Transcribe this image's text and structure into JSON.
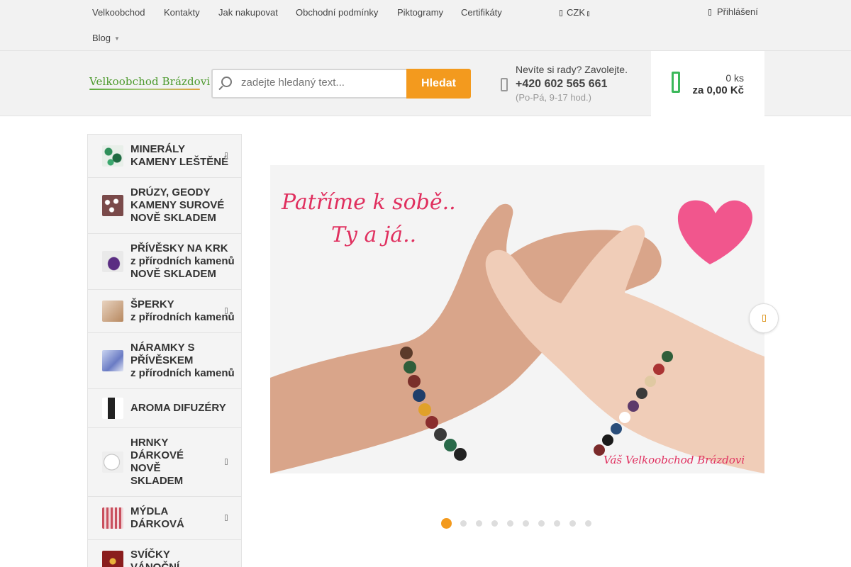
{
  "topnav": {
    "items": [
      "Velkoobchod",
      "Kontakty",
      "Jak nakupovat",
      "Obchodní podmínky",
      "Piktogramy",
      "Certifikáty"
    ],
    "blog": "Blog"
  },
  "currency": "CZK",
  "login": "Přihlášení",
  "logo": "Velkoobchod Brázdovi",
  "search": {
    "placeholder": "zadejte hledaný text...",
    "button": "Hledat"
  },
  "contact": {
    "question": "Nevíte si rady? Zavolejte.",
    "phone": "+420 602 565 661",
    "hours": "(Po-Pá, 9-17 hod.)"
  },
  "cart": {
    "count": "0 ks",
    "total": "za 0,00 Kč"
  },
  "categories": [
    {
      "lines": [
        "MINERÁLY",
        "KAMENY LEŠTĚNÉ"
      ],
      "has_arrow": true
    },
    {
      "lines": [
        "DRÚZY, GEODY",
        "KAMENY SUROVÉ",
        "NOVĚ SKLADEM"
      ],
      "has_arrow": false
    },
    {
      "lines": [
        "PŘÍVĚSKY NA KRK",
        "z přírodních kamenů",
        "NOVĚ SKLADEM"
      ],
      "has_arrow": false
    },
    {
      "lines": [
        "ŠPERKY",
        "z přírodních kamenů"
      ],
      "has_arrow": true
    },
    {
      "lines": [
        "NÁRAMKY S",
        "PŘÍVĚSKEM",
        "z přírodních kamenů"
      ],
      "has_arrow": false
    },
    {
      "lines": [
        "AROMA DIFUZÉRY"
      ],
      "has_arrow": false
    },
    {
      "lines": [
        "HRNKY",
        "DÁRKOVÉ",
        "NOVĚ",
        "SKLADEM"
      ],
      "has_arrow": true
    },
    {
      "lines": [
        "MÝDLA",
        "DÁRKOVÁ"
      ],
      "has_arrow": true
    },
    {
      "lines": [
        "SVÍČKY",
        "VÁNOČNÍ"
      ],
      "has_arrow": false
    }
  ],
  "slide": {
    "headline_1": "Patříme k sobě..",
    "headline_2": "Ty a já..",
    "signature": "Váš Velkoobchod Brázdovi",
    "active_index": 0,
    "total": 10
  },
  "colors": {
    "accent": "#f39a1e",
    "green": "#4d9a2e",
    "heart": "#f0397a"
  }
}
